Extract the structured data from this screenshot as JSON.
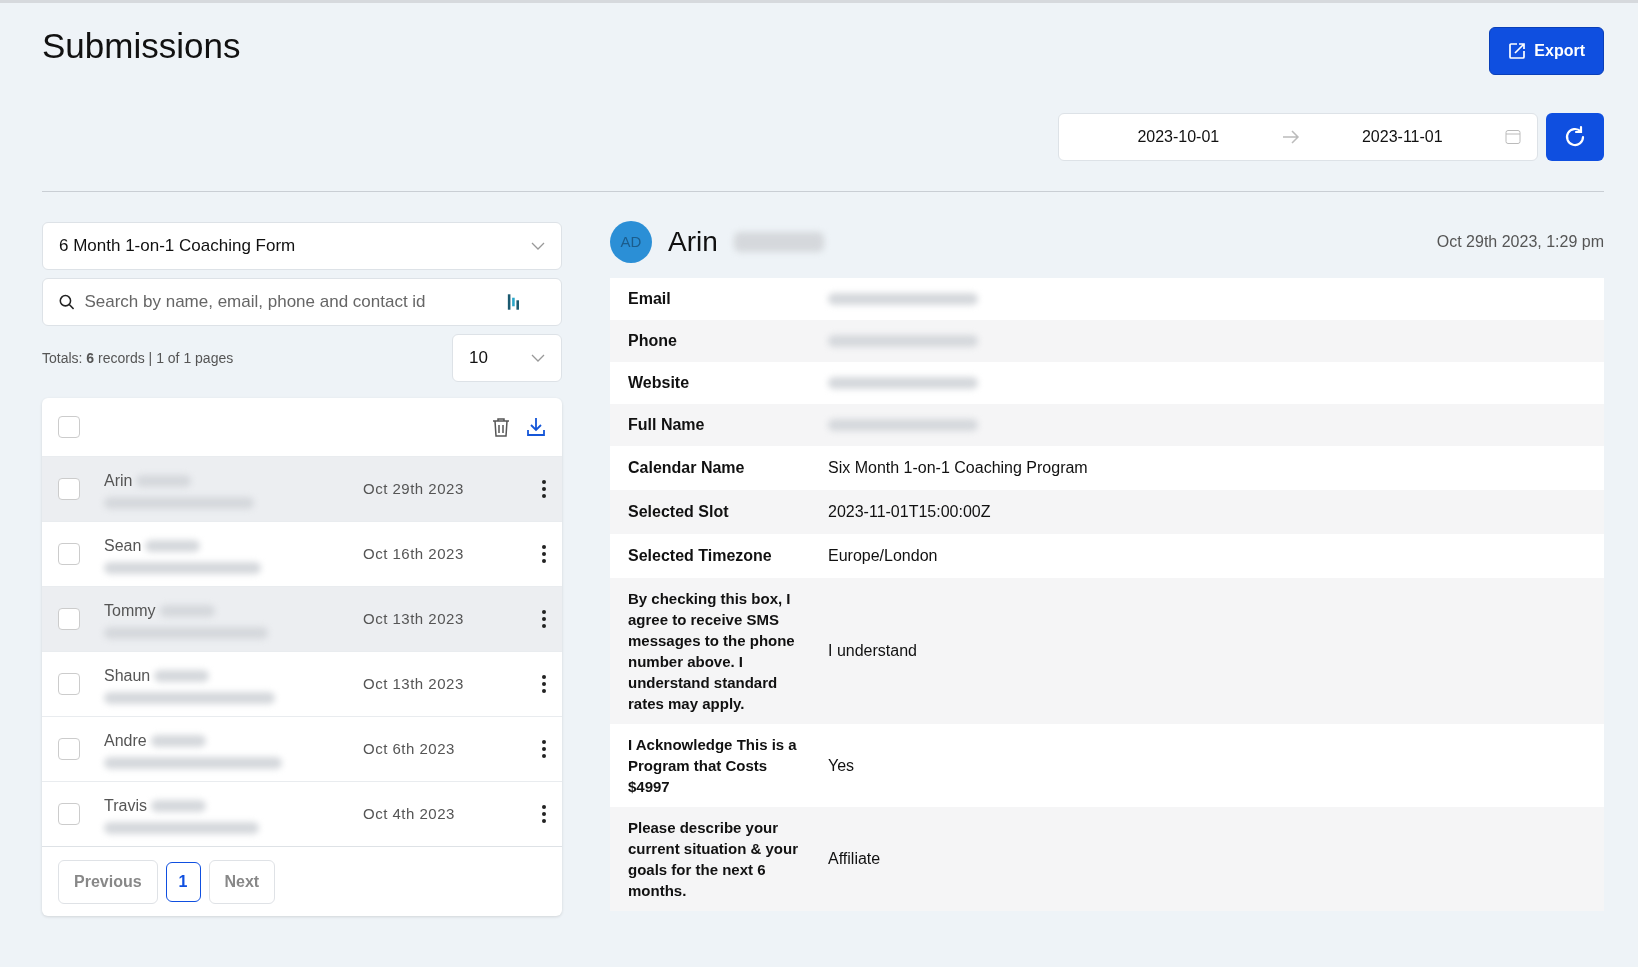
{
  "page": {
    "title": "Submissions"
  },
  "export_button": {
    "label": "Export"
  },
  "date_range": {
    "start": "2023-10-01",
    "end": "2023-11-01"
  },
  "form_select": {
    "value": "6 Month 1-on-1 Coaching Form"
  },
  "search": {
    "placeholder": "Search by name, email, phone and contact id"
  },
  "totals": {
    "text": "Totals: **6** records | 1 of 1 pages"
  },
  "page_size": {
    "value": "10"
  },
  "list_header": {
    "checked": false
  },
  "submissions": [
    {
      "name": "Arin",
      "date": "Oct 29th 2023",
      "checked": false,
      "selected": true
    },
    {
      "name": "Sean",
      "date": "Oct 16th 2023",
      "checked": false,
      "selected": false
    },
    {
      "name": "Tommy",
      "date": "Oct 13th 2023",
      "checked": false,
      "selected": true
    },
    {
      "name": "Shaun",
      "date": "Oct 13th 2023",
      "checked": false,
      "selected": false
    },
    {
      "name": "Andre",
      "date": "Oct 6th 2023",
      "checked": false,
      "selected": false
    },
    {
      "name": "Travis",
      "date": "Oct 4th 2023",
      "checked": false,
      "selected": false
    }
  ],
  "pagination": [
    {
      "label": "Previous",
      "selected": false
    },
    {
      "label": "1",
      "selected": true
    },
    {
      "label": "Next",
      "selected": false
    }
  ],
  "detail": {
    "initials": "AD",
    "name": "Arin",
    "submitted": "Oct 29th 2023, 1:29 pm",
    "fields": [
      {
        "label": "Email",
        "hidden": true
      },
      {
        "label": "Phone",
        "hidden": true
      },
      {
        "label": "Website",
        "hidden": true
      },
      {
        "label": "Full Name",
        "hidden": true
      },
      {
        "label": "Calendar Name",
        "value": "Six Month 1-on-1 Coaching Program"
      },
      {
        "label": "Selected Slot",
        "value": "2023-11-01T15:00:00Z"
      },
      {
        "label": "Selected Timezone",
        "value": "Europe/London"
      },
      {
        "label": "By checking this box, I agree to receive SMS messages to the phone number above. I understand standard rates may apply.",
        "value": "I understand"
      },
      {
        "label": "I Acknowledge This is a Program that Costs $4997",
        "value": "Yes"
      },
      {
        "label": "Please describe your current situation & your goals for the next 6 months.",
        "value": "Affiliate"
      }
    ]
  }
}
